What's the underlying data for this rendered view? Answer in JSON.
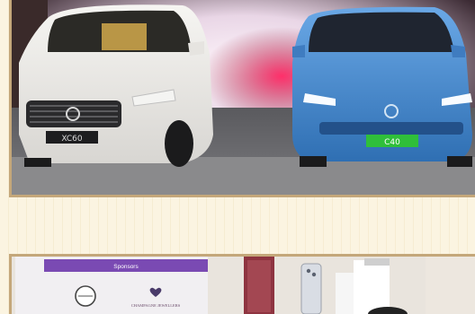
{
  "photos": [
    {
      "car_left_badge": "XC60",
      "car_right_badge": "C40",
      "colors": {
        "frame": "#c4a77a",
        "white_car": "#eceae6",
        "blue_car": "#4b8fd4",
        "green_plate": "#2fbf3a",
        "magenta_glow": "#d63a6e"
      }
    },
    {
      "banner_title": "Sponsors",
      "sponsor_name": "CHAMPAGNE JEWELLERS",
      "colors": {
        "banner": "#7a4ab3",
        "board": "#f1eff2"
      }
    }
  ]
}
